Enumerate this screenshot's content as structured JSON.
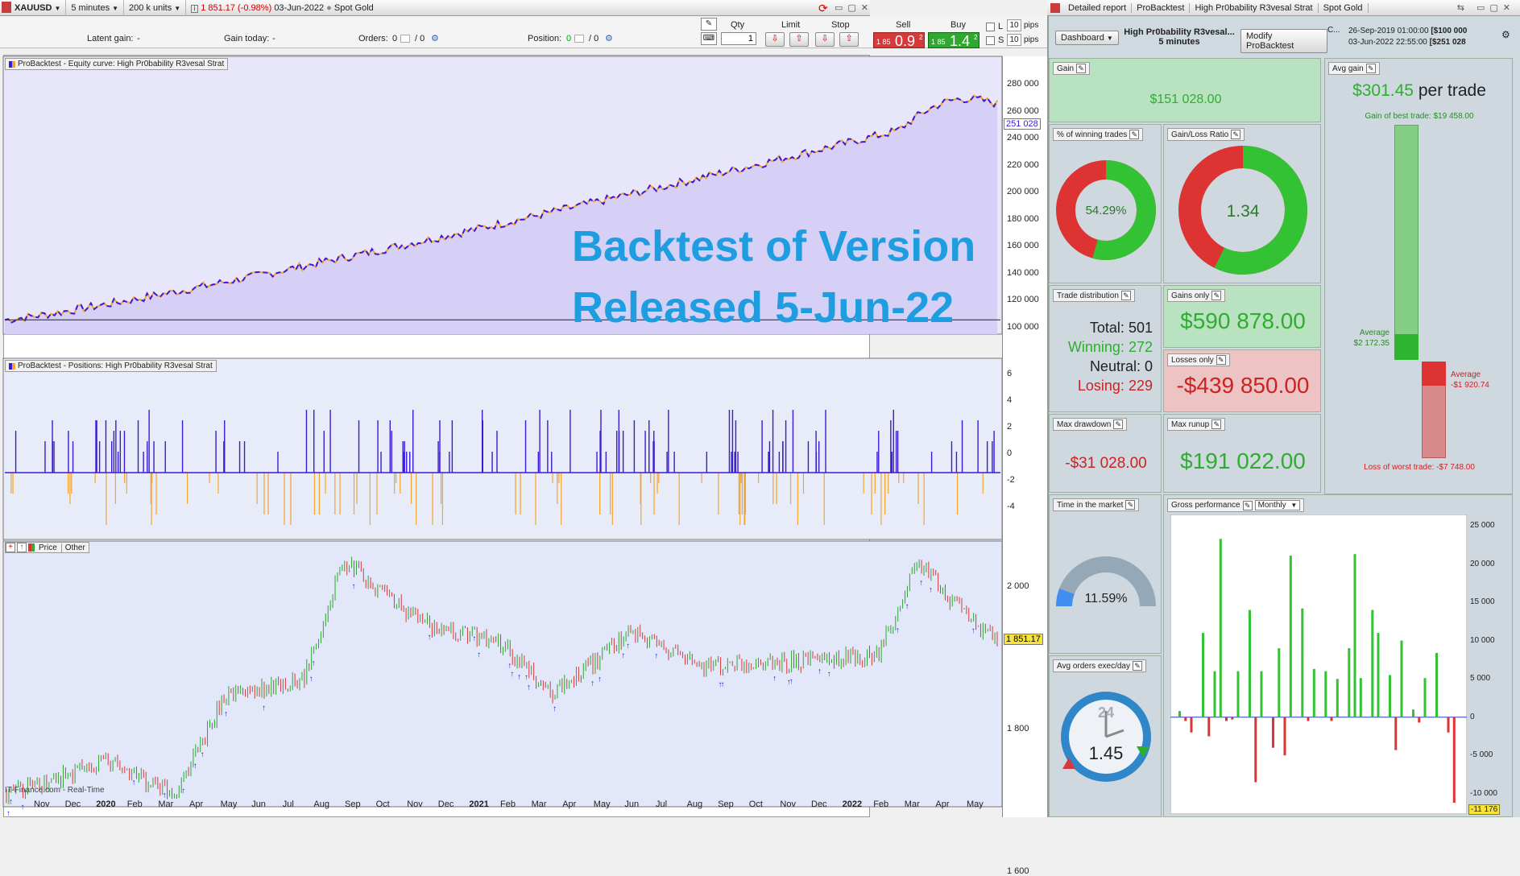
{
  "toolbar": {
    "instrument": "XAUUSD",
    "timeframe": "5 minutes",
    "units": "200 k units",
    "price_change": "1 851.17 (-0.98%)",
    "date": "03-Jun-2022",
    "instrument_name": "Spot Gold",
    "latent_gain_label": "Latent gain:",
    "latent_gain_value": "-",
    "gain_today_label": "Gain today:",
    "gain_today_value": "-",
    "orders_label": "Orders:",
    "orders_value": "0",
    "orders_sep": "/ 0",
    "position_label": "Position:",
    "position_value": "0",
    "position_sep": "/ 0",
    "qty_label": "Qty",
    "qty_value": "1",
    "limit_label": "Limit",
    "stop_label": "Stop",
    "sell_label": "Sell",
    "sell_price_small": "1 85",
    "sell_price_big": "0.9",
    "sell_price_sup": "2",
    "buy_label": "Buy",
    "buy_price_small": "1 85",
    "buy_price_big": "1.4",
    "buy_price_sup": "2",
    "l_label": "L",
    "s_label": "S",
    "pips_value": "10",
    "pips_label": "pips"
  },
  "right_header": {
    "tab_report": "Detailed report",
    "tab_probacktest": "ProBacktest",
    "tab_strategy": "High Pr0bability R3vesal Strat",
    "tab_instrument": "Spot Gold",
    "dashboard_label": "Dashboard",
    "strategy_title": "High Pr0bability R3vesal...",
    "strategy_timeframe": "5 minutes",
    "modify_button": "Modify ProBacktest",
    "date_start": "26-Sep-2019 01:00:00",
    "capital_start": "[$100 000",
    "date_end": "03-Jun-2022 22:55:00",
    "capital_end": "[$251 028",
    "c_label": "C..."
  },
  "charts": {
    "equity_title": "ProBacktest - Equity curve: High Pr0bability R3vesal Strat",
    "positions_title": "ProBacktest - Positions: High Pr0bability R3vesal Strat",
    "price_tab": "Price",
    "other_tab": "Other",
    "overlay_line1": "Backtest of Version",
    "overlay_line2": "Released 5-Jun-22",
    "equity_current": "251 028",
    "price_current": "1 851.17",
    "equity_ticks": [
      "280 000",
      "260 000",
      "240 000",
      "220 000",
      "200 000",
      "180 000",
      "160 000",
      "140 000",
      "120 000",
      "100 000"
    ],
    "position_ticks": [
      "6",
      "4",
      "2",
      "0",
      "-2",
      "-4"
    ],
    "price_ticks": [
      "2 000",
      "1 800",
      "1 600"
    ],
    "x_labels": [
      "Nov",
      "Dec",
      "2020",
      "Feb",
      "Mar",
      "Apr",
      "May",
      "Jun",
      "Jul",
      "Aug",
      "Sep",
      "Oct",
      "Nov",
      "Dec",
      "2021",
      "Feb",
      "Mar",
      "Apr",
      "May",
      "Jun",
      "Jul",
      "Aug",
      "Sep",
      "Oct",
      "Nov",
      "Dec",
      "2022",
      "Feb",
      "Mar",
      "Apr",
      "May"
    ],
    "source": "IT-Finance.com - Real-Time"
  },
  "dashboard": {
    "gain_title": "Gain",
    "gain_value": "$151 028.00",
    "avg_gain_title": "Avg gain",
    "avg_gain_value": "$301.45",
    "avg_gain_unit": "per trade",
    "best_trade": "Gain of best trade: $19 458.00",
    "avg_win_label": "Average",
    "avg_win_value": "$2 172.35",
    "avg_loss_label": "Average",
    "avg_loss_value": "-$1 920.74",
    "worst_trade": "Loss of worst trade: -$7 748.00",
    "winning_pct_title": "% of winning trades",
    "winning_pct_value": "54.29%",
    "gain_loss_ratio_title": "Gain/Loss Ratio",
    "gain_loss_ratio_value": "1.34",
    "trade_dist_title": "Trade distribution",
    "total_label": "Total:",
    "total_value": "501",
    "winning_label": "Winning:",
    "winning_value": "272",
    "neutral_label": "Neutral:",
    "neutral_value": "0",
    "losing_label": "Losing:",
    "losing_value": "229",
    "gains_only_title": "Gains only",
    "gains_only_value": "$590 878.00",
    "losses_only_title": "Losses only",
    "losses_only_value": "-$439 850.00",
    "max_drawdown_title": "Max drawdown",
    "max_drawdown_value": "-$31 028.00",
    "max_runup_title": "Max runup",
    "max_runup_value": "$191 022.00",
    "time_in_market_title": "Time in the market",
    "time_in_market_value": "11.59%",
    "avg_orders_title": "Avg orders exec/day",
    "avg_orders_value": "1.45",
    "clock_label": "24",
    "gross_perf_title": "Gross performance",
    "gross_perf_period": "Monthly",
    "gross_ticks": [
      "25 000",
      "20 000",
      "15 000",
      "10 000",
      "5 000",
      "0",
      "-5 000",
      "-10 000"
    ],
    "gross_min_label": "-11 176"
  },
  "chart_data": {
    "type": "bar",
    "title": "Gross performance",
    "ylim": [
      -11176,
      25000
    ],
    "values": [
      800,
      -500,
      -2000,
      0,
      11000,
      -2500,
      6000,
      23300,
      -500,
      -300,
      6000,
      0,
      14000,
      -8500,
      6000,
      0,
      -4000,
      9000,
      -5000,
      21100,
      0,
      14200,
      -500,
      6300,
      0,
      6000,
      -500,
      5000,
      0,
      9000,
      21300,
      5100,
      0,
      14000,
      11000,
      0,
      5500,
      -4300,
      10000,
      0,
      1000,
      -700,
      5100,
      0,
      8400,
      0,
      -2000,
      -11176
    ]
  },
  "colors": {
    "green": "#33c233",
    "red": "#dd3333",
    "title_blue": "#1e9ee0",
    "equity_line": "#3a1ad6",
    "equity_fill": "#d6d0f6",
    "position_neg": "#f3a530"
  }
}
